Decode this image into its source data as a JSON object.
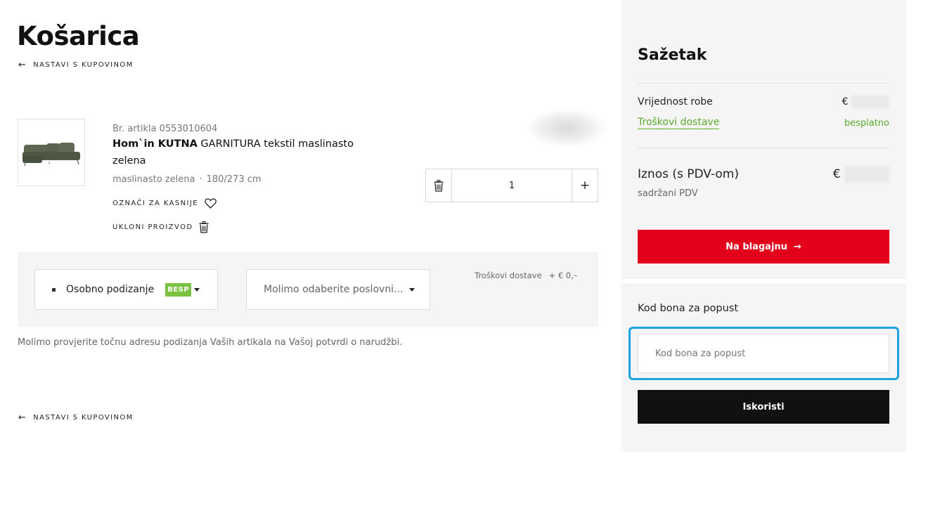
{
  "page": {
    "title": "Košarica"
  },
  "continue_link": {
    "label": "NASTAVI S KUPOVINOM"
  },
  "item": {
    "sku": "Br. artikla 0553010604",
    "brand": "Hom`in KUTNA",
    "name_rest": " GARNITURA tekstil maslinasto zelena",
    "color": "maslinasto zelena",
    "separator": "·",
    "size": "180/273 cm",
    "save_label": "OZNAČI ZA KASNIJE",
    "remove_label": "UKLONI PROIZVOD",
    "quantity": "1"
  },
  "delivery": {
    "pickup_label": "Osobno podizanje",
    "pickup_badge": "BESP",
    "store_placeholder": "Molimo odaberite poslovni...",
    "cost_label": "Troškovi dostave",
    "cost_value": "+ € 0,–",
    "note": "Molimo provjerite točnu adresu podizanja Vaših artikala na Vašoj potvrdi o narudžbi."
  },
  "summary": {
    "title": "Sažetak",
    "goods_label": "Vrijednost robe",
    "currency": "€",
    "shipping_label": "Troškovi dostave",
    "shipping_value": "besplatno",
    "total_label": "Iznos (s PDV-om)",
    "vat_note": "sadržani PDV",
    "checkout_label": "Na blagajnu"
  },
  "coupon": {
    "title": "Kod bona za popust",
    "placeholder": "Kod bona za popust",
    "apply_label": "Iskoristi"
  },
  "colors": {
    "accent_red": "#e2001a",
    "green": "#5aaa2e",
    "highlight_blue": "#1aa3df",
    "panel_bg": "#f5f5f5"
  }
}
